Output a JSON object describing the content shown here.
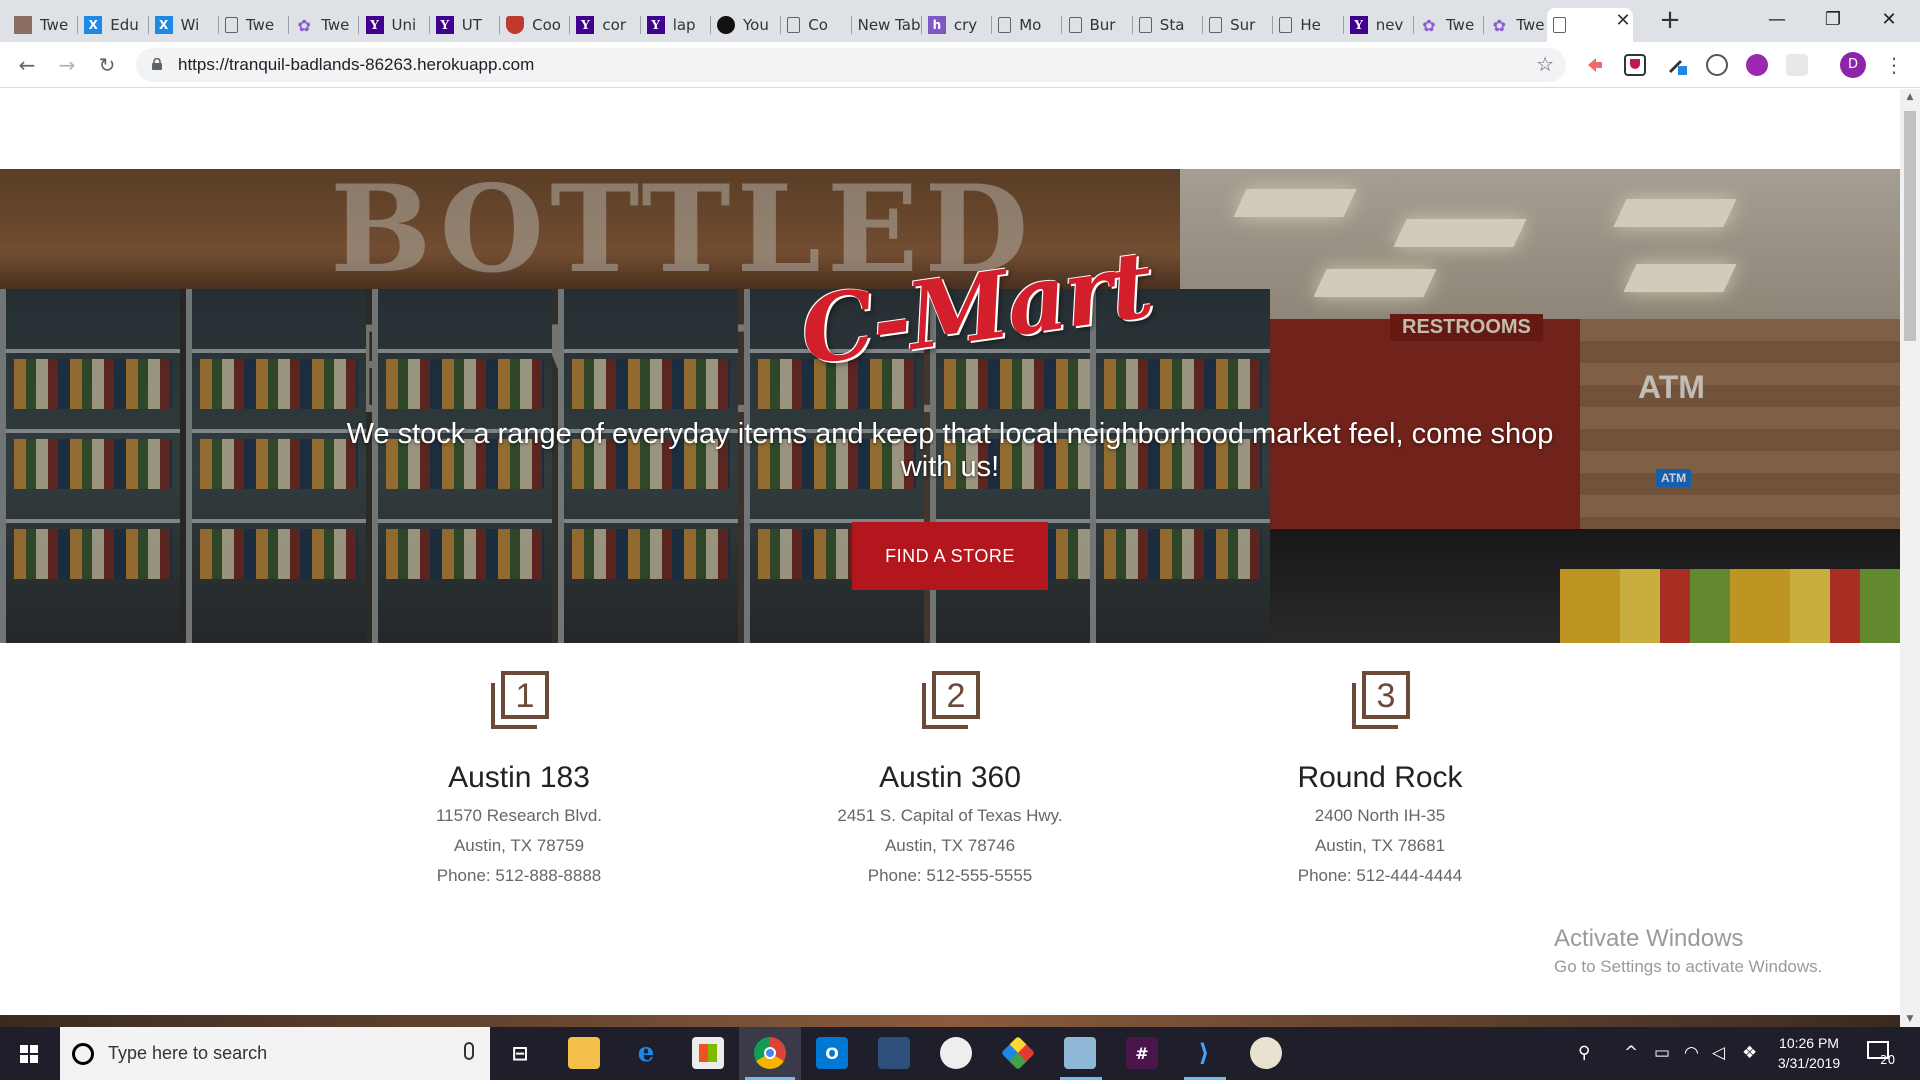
{
  "browser": {
    "tabs": [
      {
        "label": "Twe",
        "icon": "brown"
      },
      {
        "label": "Edu",
        "icon": "x"
      },
      {
        "label": "Wi",
        "icon": "x"
      },
      {
        "label": "Twe",
        "icon": "doc"
      },
      {
        "label": "Twe",
        "icon": "twine"
      },
      {
        "label": "Uni",
        "icon": "yahoo"
      },
      {
        "label": "UT",
        "icon": "yahoo"
      },
      {
        "label": "Coo",
        "icon": "shield"
      },
      {
        "label": "cor",
        "icon": "yahoo"
      },
      {
        "label": "lap",
        "icon": "yahoo"
      },
      {
        "label": "You",
        "icon": "github"
      },
      {
        "label": "Co",
        "icon": "doc"
      },
      {
        "label": "New Tab",
        "icon": "none"
      },
      {
        "label": "cry",
        "icon": "h"
      },
      {
        "label": "Mo",
        "icon": "doc"
      },
      {
        "label": "Bur",
        "icon": "doc"
      },
      {
        "label": "Sta",
        "icon": "doc"
      },
      {
        "label": "Sur",
        "icon": "doc"
      },
      {
        "label": "He",
        "icon": "doc"
      },
      {
        "label": "nev",
        "icon": "yahoo"
      },
      {
        "label": "Twe",
        "icon": "twine"
      },
      {
        "label": "Twe",
        "icon": "twine"
      },
      {
        "label": "",
        "icon": "doc",
        "active": true
      }
    ],
    "close_tab_glyph": "✕",
    "new_tab_glyph": "+",
    "window_controls": {
      "minimize": "—",
      "restore": "❐",
      "close": "✕"
    },
    "url": "https://tranquil-badlands-86263.herokuapp.com",
    "profile_initial": "D"
  },
  "page": {
    "hero": {
      "logo": "C-Mart",
      "tagline": "We stock a range of everyday items and keep that local neighborhood market feel, come shop with us!",
      "cta_label": "FIND A STORE",
      "background_signs": {
        "restrooms": "RESTROOMS",
        "atm": "ATM",
        "atm_small": "ATM",
        "beam": "BOTTLED BEVERAGES"
      }
    },
    "stores": [
      {
        "number": "1",
        "name": "Austin 183",
        "street": "11570 Research Blvd.",
        "city": "Austin, TX 78759",
        "phone": "Phone: 512-888-8888"
      },
      {
        "number": "2",
        "name": "Austin 360",
        "street": "2451 S. Capital of Texas Hwy.",
        "city": "Austin, TX 78746",
        "phone": "Phone: 512-555-5555"
      },
      {
        "number": "3",
        "name": "Round Rock",
        "street": "2400 North IH-35",
        "city": "Austin, TX 78681",
        "phone": "Phone: 512-444-4444"
      }
    ],
    "accent_color": "#b4161e",
    "icon_color": "#6b4a3a"
  },
  "watermark": {
    "title": "Activate Windows",
    "subtitle": "Go to Settings to activate Windows."
  },
  "taskbar": {
    "search_placeholder": "Type here to search",
    "time": "10:26 PM",
    "date": "3/31/2019",
    "notification_count": "20"
  }
}
